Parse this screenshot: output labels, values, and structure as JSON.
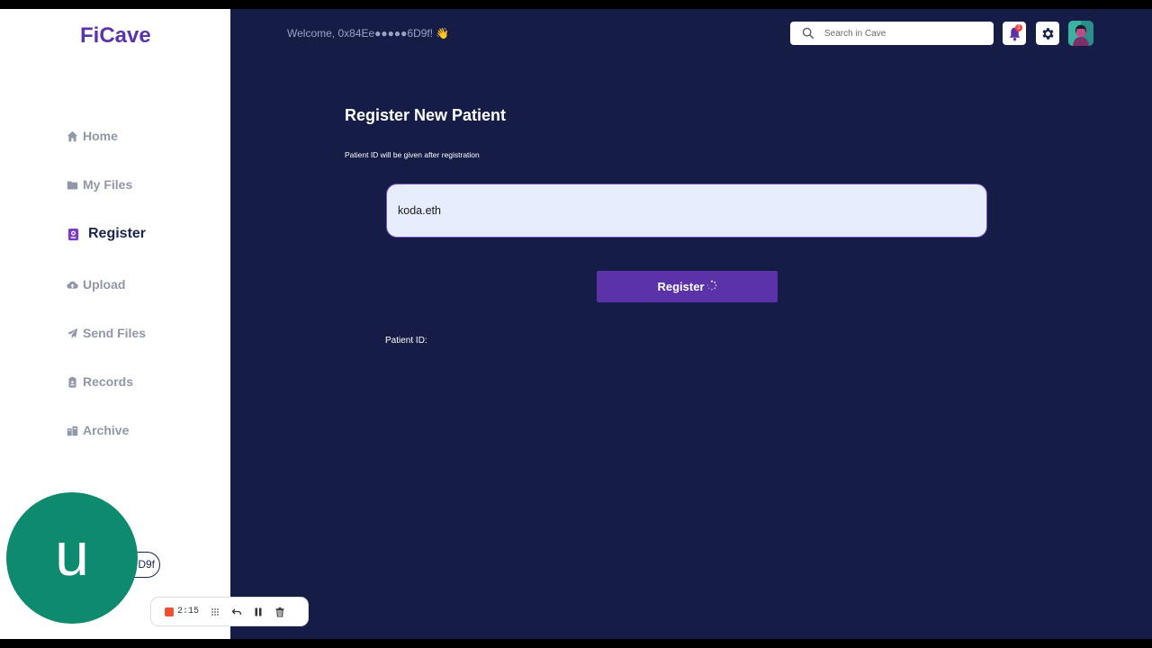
{
  "app": {
    "logo": "FiCave"
  },
  "sidebar": {
    "items": [
      {
        "label": "Home",
        "icon": "home-icon"
      },
      {
        "label": "My Files",
        "icon": "folder-icon"
      },
      {
        "label": "Register",
        "icon": "id-card-icon",
        "active": true
      },
      {
        "label": "Upload",
        "icon": "cloud-upload-icon"
      },
      {
        "label": "Send Files",
        "icon": "paper-plane-icon"
      },
      {
        "label": "Records",
        "icon": "clipboard-icon"
      },
      {
        "label": "Archive",
        "icon": "archive-icon"
      }
    ],
    "wallet_suffix": "D9f"
  },
  "header": {
    "welcome": "Welcome, 0x84Ee●●●●●6D9f! 👋",
    "search_placeholder": "Search in Cave",
    "notification_count": "1"
  },
  "main": {
    "title": "Register New Patient",
    "subtitle": "Patient ID will be given after registration",
    "name_value": "koda.eth",
    "register_label": "Register",
    "patient_id_label": "Patient ID:"
  },
  "overlay": {
    "user_initial": "u",
    "recording_time": "2:15"
  },
  "colors": {
    "accent": "#5b32a7",
    "main_bg": "#151c45",
    "sidebar_bg": "#ffffff",
    "bubble": "#0e8a6f",
    "record": "#ee5130"
  }
}
